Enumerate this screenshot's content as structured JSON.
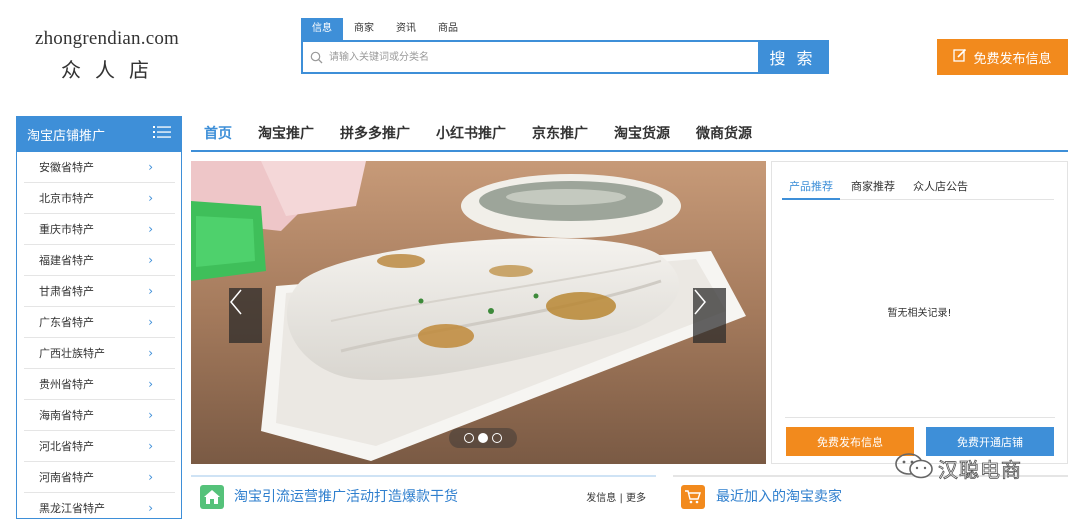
{
  "logo": {
    "domain": "zhongrendian.com",
    "name": "众人店"
  },
  "search": {
    "tabs": [
      "信息",
      "商家",
      "资讯",
      "商品"
    ],
    "active_tab": 0,
    "placeholder": "请输入关键词或分类名",
    "button_label": "搜 索"
  },
  "publish_button": {
    "label": "免费发布信息"
  },
  "sidebar": {
    "title": "淘宝店铺推广",
    "items": [
      {
        "label": "安徽省特产"
      },
      {
        "label": "北京市特产"
      },
      {
        "label": "重庆市特产"
      },
      {
        "label": "福建省特产"
      },
      {
        "label": "甘肃省特产"
      },
      {
        "label": "广东省特产"
      },
      {
        "label": "广西壮族特产"
      },
      {
        "label": "贵州省特产"
      },
      {
        "label": "海南省特产"
      },
      {
        "label": "河北省特产"
      },
      {
        "label": "河南省特产"
      },
      {
        "label": "黑龙江省特产"
      }
    ],
    "chevron": "›"
  },
  "nav": {
    "items": [
      {
        "label": "首页",
        "active": true
      },
      {
        "label": "淘宝推广"
      },
      {
        "label": "拼多多推广"
      },
      {
        "label": "小红书推广"
      },
      {
        "label": "京东推广"
      },
      {
        "label": "淘宝货源"
      },
      {
        "label": "微商货源"
      }
    ]
  },
  "slider": {
    "slide_count": 3,
    "active_slide": 1
  },
  "panel": {
    "tabs": [
      "产品推荐",
      "商家推荐",
      "众人店公告"
    ],
    "active_tab": 0,
    "empty_message": "暂无相关记录!",
    "publish_button": "免费发布信息",
    "open_store_button": "免费开通店铺"
  },
  "sections": {
    "left": {
      "title": "淘宝引流运营推广活动打造爆款干货",
      "more": "发信息 | 更多"
    },
    "right": {
      "title": "最近加入的淘宝卖家"
    }
  },
  "watermark": {
    "text": "汉聪电商"
  },
  "colors": {
    "primary": "#3e8fd8",
    "accent": "#f28a1d",
    "green": "#55c27a"
  }
}
